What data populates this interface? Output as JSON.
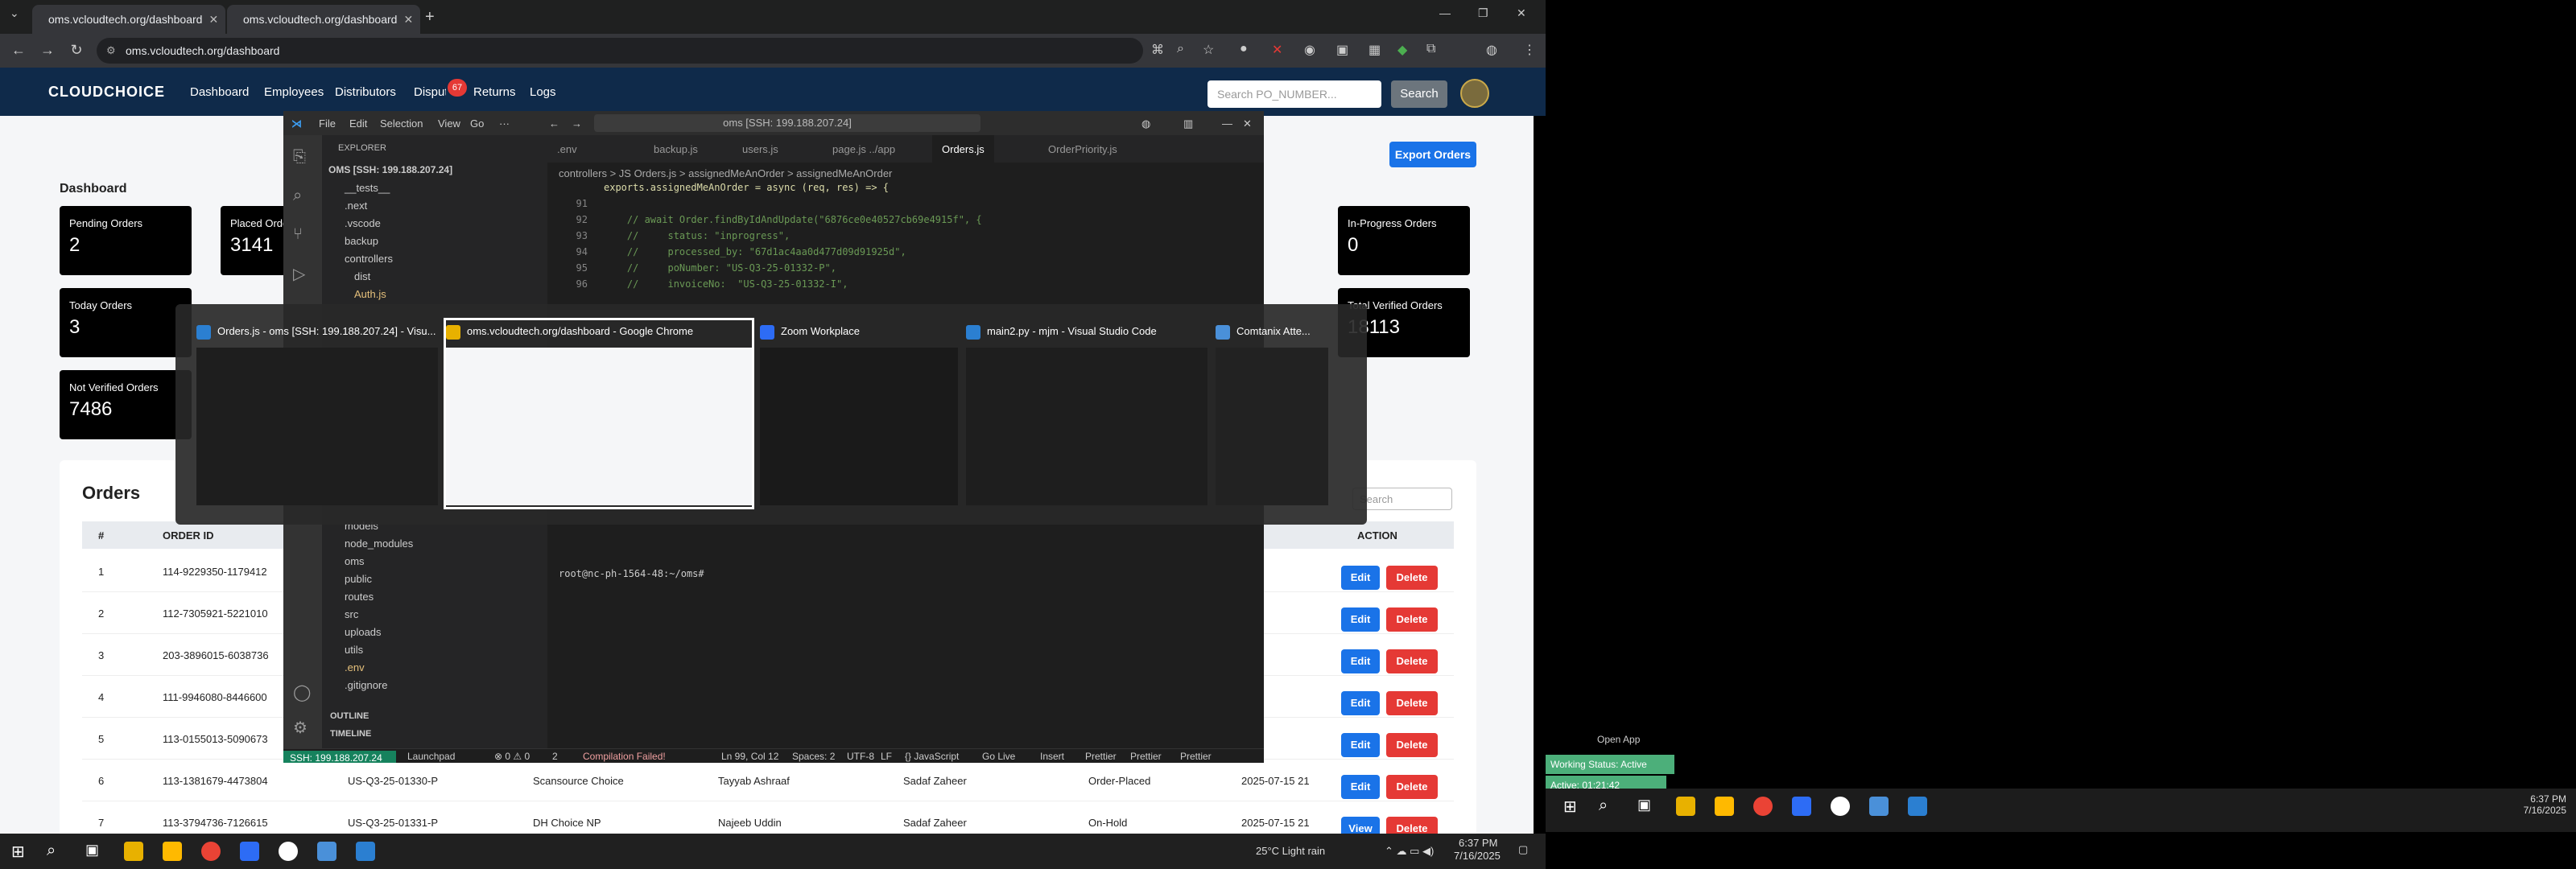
{
  "browser": {
    "tabs": [
      {
        "title": "oms.vcloudtech.org/dashboard"
      },
      {
        "title": "oms.vcloudtech.org/dashboard"
      }
    ],
    "url": "oms.vcloudtech.org/dashboard"
  },
  "site": {
    "logo": "CLOUDCHOICE",
    "nav": [
      "Dashboard",
      "Employees",
      "Distributors",
      "Disputes",
      "Returns",
      "Logs"
    ],
    "disputes_badge": "67",
    "search_placeholder": "Search PO_NUMBER...",
    "search_button": "Search",
    "dashboard_title": "Dashboard",
    "export_button": "Export Orders"
  },
  "cards": [
    {
      "label": "Pending Orders",
      "value": "2"
    },
    {
      "label": "Placed Orders",
      "value": "3141"
    },
    {
      "label": "In-Progress Orders",
      "value": "0"
    },
    {
      "label": "Today Orders",
      "value": "3"
    },
    {
      "label": "Total Verified Orders",
      "value": "18113"
    },
    {
      "label": "Not Verified Orders",
      "value": "7486"
    }
  ],
  "orders": {
    "title": "Orders",
    "search_placeholder": "Search",
    "headers": [
      "#",
      "ORDER ID",
      "ACTION"
    ],
    "edit_label": "Edit",
    "delete_label": "Delete",
    "view_label": "View",
    "rows": [
      {
        "n": "1",
        "id": "114-9229350-1179412",
        "po": "",
        "dist": "",
        "placed": "",
        "emp": "",
        "status": "",
        "date": ""
      },
      {
        "n": "2",
        "id": "112-7305921-5221010",
        "po": "",
        "dist": "",
        "placed": "",
        "emp": "",
        "status": "",
        "date": ""
      },
      {
        "n": "3",
        "id": "203-3896015-6038736",
        "po": "",
        "dist": "",
        "placed": "",
        "emp": "",
        "status": "",
        "date": ""
      },
      {
        "n": "4",
        "id": "111-9946080-8446600",
        "po": "",
        "dist": "",
        "placed": "",
        "emp": "",
        "status": "",
        "date": ""
      },
      {
        "n": "5",
        "id": "113-0155013-5090673",
        "po": "",
        "dist": "",
        "placed": "",
        "emp": "",
        "status": "",
        "date": ""
      },
      {
        "n": "6",
        "id": "113-1381679-4473804",
        "po": "US-Q3-25-01330-P",
        "dist": "Scansource Choice",
        "placed": "Tayyab Ashraaf",
        "emp": "Sadaf Zaheer",
        "status": "Order-Placed",
        "date": "2025-07-15 21"
      },
      {
        "n": "7",
        "id": "113-3794736-7126615",
        "po": "US-Q3-25-01331-P",
        "dist": "DH Choice NP",
        "placed": "Najeeb Uddin",
        "emp": "Sadaf Zaheer",
        "status": "On-Hold",
        "date": "2025-07-15 21"
      }
    ]
  },
  "vscode": {
    "menu": [
      "File",
      "Edit",
      "Selection",
      "View",
      "Go"
    ],
    "command": "oms [SSH: 199.188.207.24]",
    "explorer_header": "EXPLORER",
    "workspace": "OMS [SSH: 199.188.207.24]",
    "tree": [
      "__tests__",
      ".next",
      ".vscode",
      "backup",
      "controllers",
      "dist",
      "Auth.js",
      "models",
      "node_modules",
      "oms",
      "public",
      "routes",
      "src",
      "uploads",
      "utils",
      ".env",
      ".gitignore"
    ],
    "outline": "OUTLINE",
    "timeline": "TIMELINE",
    "tabs": [
      ".env",
      "backup.js",
      "users.js",
      "page.js ../app",
      "Orders.js",
      "OrderPriority.js"
    ],
    "breadcrumb": "controllers  >  JS Orders.js  >  assignedMeAnOrder  >  assignedMeAnOrder",
    "code": [
      {
        "n": "",
        "t": "exports.assignedMeAnOrder = async (req, res) => {"
      },
      {
        "n": "91",
        "t": ""
      },
      {
        "n": "92",
        "t": "    // await Order.findByIdAndUpdate(\"6876ce0e40527cb69e4915f\", {"
      },
      {
        "n": "93",
        "t": "    //     status: \"inprogress\","
      },
      {
        "n": "94",
        "t": "    //     processed_by: \"67d1ac4aa0d477d09d91925d\","
      },
      {
        "n": "95",
        "t": "    //     poNumber: \"US-Q3-25-01332-P\","
      },
      {
        "n": "96",
        "t": "    //     invoiceNo:  \"US-Q3-25-01332-I\","
      }
    ],
    "terminal": "root@nc-ph-1564-48:~/oms#",
    "status": {
      "ssh": "SSH: 199.188.207.24",
      "launchpad": "Launchpad",
      "problems": "⊗ 0 ⚠ 0",
      "ports": "2",
      "compile": "Compilation Failed!",
      "position": "Ln 99, Col 12",
      "spaces": "Spaces: 2",
      "encoding": "UTF-8",
      "eol": "LF",
      "lang": "{} JavaScript",
      "golive": "Go Live",
      "insert": "Insert",
      "prettier1": "Prettier",
      "prettier2": "Prettier",
      "prettier3": "Prettier"
    }
  },
  "alttab": [
    {
      "title": "Orders.js - oms [SSH: 199.188.207.24] - Visu...",
      "icon_color": "#2b7fd1"
    },
    {
      "title": "oms.vcloudtech.org/dashboard - Google Chrome",
      "icon_color": "#e8b100"
    },
    {
      "title": "Zoom Workplace",
      "icon_color": "#2d6cf5"
    },
    {
      "title": "main2.py - mjm - Visual Studio Code",
      "icon_color": "#2b7fd1"
    },
    {
      "title": "Comtanix Atte...",
      "icon_color": "#4a90d9"
    }
  ],
  "taskbar": {
    "weather": "25°C  Light rain",
    "time": "6:37 PM",
    "date": "7/16/2025"
  },
  "right": {
    "open_app": "Open App",
    "working_status": "Working Status: Active",
    "active_timer": "Active: 01:21:42",
    "time": "6:37 PM",
    "date": "7/16/2025"
  }
}
